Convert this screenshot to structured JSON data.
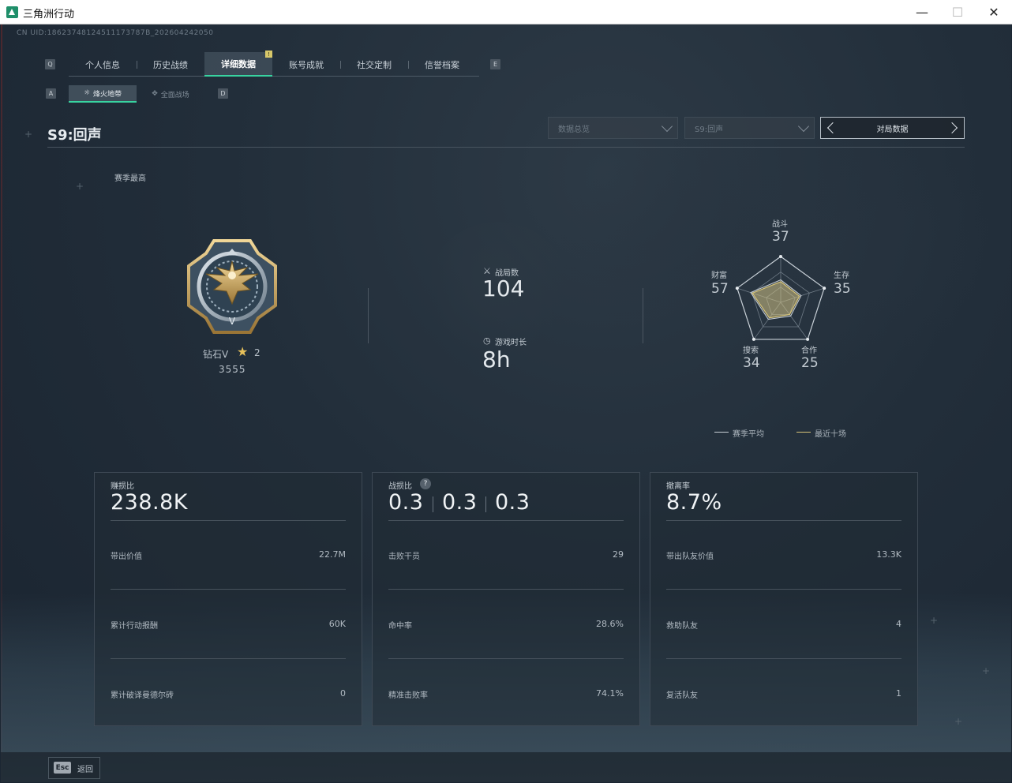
{
  "window": {
    "title": "三角洲行动"
  },
  "uid": "CN UID:18623748124511173787B_202604242050",
  "tabs": {
    "left_key": "Q",
    "right_key": "E",
    "items": [
      {
        "label": "个人信息"
      },
      {
        "label": "历史战绩"
      },
      {
        "label": "详细数据"
      },
      {
        "label": "账号成就"
      },
      {
        "label": "社交定制"
      },
      {
        "label": "信誉档案"
      }
    ],
    "badge": "!"
  },
  "subtabs": {
    "left_key": "A",
    "right_key": "D",
    "items": [
      {
        "label": "烽火地带"
      },
      {
        "label": "全面战场"
      }
    ]
  },
  "season": {
    "title": "S9:回声",
    "best_label": "赛季最高"
  },
  "filters": {
    "dropdown1": "数据总览",
    "dropdown2": "S9:回声",
    "switcher": "对局数据"
  },
  "rank": {
    "name": "钻石V",
    "stars": "2",
    "points": "3555"
  },
  "stats": {
    "matches_label": "战局数",
    "matches_value": "104",
    "playtime_label": "游戏时长",
    "playtime_value": "8h"
  },
  "radar": {
    "combat_label": "战斗",
    "combat_value": "37",
    "survival_label": "生存",
    "survival_value": "35",
    "cooperation_label": "合作",
    "cooperation_value": "25",
    "search_label": "搜索",
    "search_value": "34",
    "wealth_label": "财富",
    "wealth_value": "57",
    "series": [
      {
        "name": "赛季平均",
        "color": "#c8cfd5"
      },
      {
        "name": "最近十场",
        "color": "#d7c478"
      }
    ],
    "max": 100
  },
  "cards": [
    {
      "title": "赚损比",
      "main": "238.8K",
      "rows": [
        {
          "label": "带出价值",
          "value": "22.7M"
        },
        {
          "label": "累计行动报酬",
          "value": "60K"
        },
        {
          "label": "累计破译曼德尔砖",
          "value": "0"
        }
      ]
    },
    {
      "title": "战损比",
      "help": "?",
      "main_parts": [
        "0.3",
        "0.3",
        "0.3"
      ],
      "rows": [
        {
          "label": "击败干员",
          "value": "29"
        },
        {
          "label": "命中率",
          "value": "28.6%"
        },
        {
          "label": "精准击败率",
          "value": "74.1%"
        }
      ]
    },
    {
      "title": "撤离率",
      "main": "8.7%",
      "rows": [
        {
          "label": "带出队友价值",
          "value": "13.3K"
        },
        {
          "label": "救助队友",
          "value": "4"
        },
        {
          "label": "复活队友",
          "value": "1"
        }
      ]
    }
  ],
  "footer": {
    "esc_key": "Esc",
    "back_label": "返回"
  }
}
